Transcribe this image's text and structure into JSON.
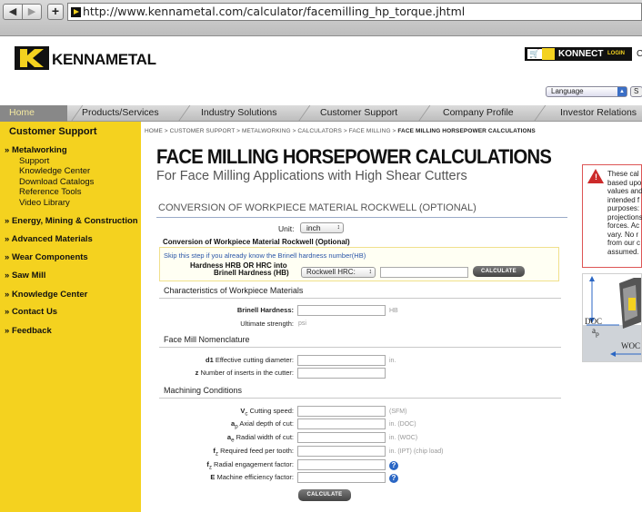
{
  "browser": {
    "back": "◀",
    "forward": "▶",
    "add": "+",
    "url": "http://www.kennametal.com/calculator/facemilling_hp_torque.jhtml"
  },
  "header": {
    "logo_text": "KENNAMETAL",
    "konnect": "KONNECT",
    "login": "LOGIN",
    "konnect_tail": "C",
    "language": "Language",
    "lang_extra": "S"
  },
  "nav": {
    "items": [
      "Home",
      "Products/Services",
      "Industry Solutions",
      "Customer Support",
      "Company Profile",
      "Investor Relations"
    ]
  },
  "sidebar": {
    "title": "Customer Support",
    "metalworking": "Metalworking",
    "sub_items": [
      "Support",
      "Knowledge Center",
      "Download Catalogs",
      "Reference Tools",
      "Video Library"
    ],
    "sections": [
      "Energy, Mining & Construction",
      "Advanced Materials",
      "Wear Components",
      "Saw Mill",
      "Knowledge Center",
      "Contact Us",
      "Feedback"
    ]
  },
  "breadcrumb": {
    "trail": "HOME > CUSTOMER SUPPORT > METALWORKING > CALCULATORS > FACE MILLING > ",
    "current": "FACE MILLING HORSEPOWER CALCULATIONS"
  },
  "main": {
    "title": "FACE MILLING HORSEPOWER CALCULATIONS",
    "subtitle": "For Face Milling Applications with High Shear Cutters",
    "section_heading": "CONVERSION OF WORKPIECE MATERIAL ROCKWELL (OPTIONAL)"
  },
  "form": {
    "unit_label": "Unit:",
    "unit_value": "inch",
    "conversion_heading": "Conversion of Workpiece Material Rockwell (Optional)",
    "skip_note": "Skip this step if you already know the Brinell hardness number(HB)",
    "hrb_label_1": "Hardness HRB OR HRC into",
    "hrb_label_2": "Brinell Hardness (HB)",
    "rockwell_value": "Rockwell HRC:",
    "calculate": "CALCULATE",
    "characteristics_heading": "Characteristics of Workpiece Materials",
    "brinell_label": "Brinell Hardness:",
    "brinell_unit": "HB",
    "ultimate_label": "Ultimate strength:",
    "ultimate_unit": "psi",
    "nomenclature_heading": "Face Mill Nomenclature",
    "d1_prefix": "d1",
    "d1_label": " Effective cutting diameter:",
    "d1_unit": "in.",
    "z_prefix": "z",
    "z_label": " Number of inserts in the cutter:",
    "machining_heading": "Machining Conditions",
    "vc_prefix": "V",
    "vc_sub": "c",
    "vc_label": " Cutting speed:",
    "vc_unit": "(SFM)",
    "ap_prefix": "a",
    "ap_sub": "p",
    "ap_label": " Axial depth of cut:",
    "ap_unit": "in. (DOC)",
    "ae_prefix": "a",
    "ae_sub": "e",
    "ae_label": " Radial width of cut:",
    "ae_unit": "in. (WOC)",
    "fz_prefix": "f",
    "fz_sub": "z",
    "fz_label": " Required feed per tooth:",
    "fz_unit": "in. (IPT) (chip load)",
    "fz2_prefix": "f",
    "fz2_sub": "z",
    "fz2_label": " Radial engagement factor:",
    "e_prefix": "E",
    "e_label": " Machine efficiency factor:",
    "help": "?"
  },
  "right": {
    "warning_mark": "!",
    "disclaimer": "These cal\nbased upo\nvalues and\nintended f\npurposes:\nprojections\nforces. Ac\nvary. No r\nfrom our c\nassumed.",
    "doc": "DOC",
    "ap": "a",
    "ap_sub": "p",
    "woc": "WOC"
  }
}
